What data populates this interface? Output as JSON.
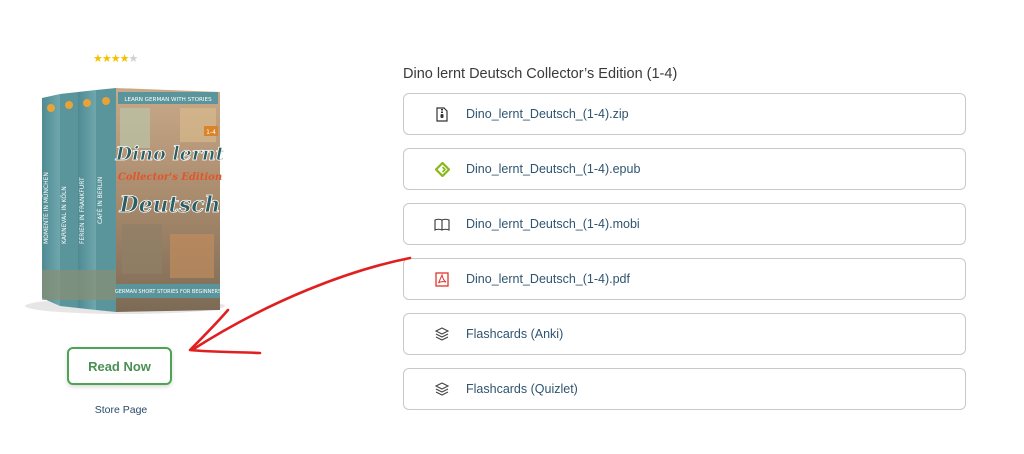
{
  "rating": {
    "value": 4.5,
    "max": 5
  },
  "cover": {
    "top_banner": "LEARN GERMAN WITH STORIES",
    "title_line1": "Dino lernt",
    "title_line2": "Deutsch",
    "edition": "Collector's Edition",
    "badge": "1-4",
    "subtitle": "GERMAN SHORT STORIES FOR BEGINNERS",
    "spines": [
      "CAFÉ IN BERLIN",
      "FERIEN IN FRANKFURT",
      "KARNEVAL IN KÖLN",
      "MOMENTE IN MÜNCHEN"
    ]
  },
  "read_button": {
    "label": "Read Now"
  },
  "store_link": {
    "label": "Store Page"
  },
  "downloads": {
    "title": "Dino lernt Deutsch Collector’s Edition (1-4)",
    "items": [
      {
        "label": "Dino_lernt_Deutsch_(1-4).zip",
        "icon": "zip-file-icon"
      },
      {
        "label": "Dino_lernt_Deutsch_(1-4).epub",
        "icon": "epub-icon"
      },
      {
        "label": "Dino_lernt_Deutsch_(1-4).mobi",
        "icon": "book-open-icon"
      },
      {
        "label": "Dino_lernt_Deutsch_(1-4).pdf",
        "icon": "pdf-icon"
      },
      {
        "label": "Flashcards (Anki)",
        "icon": "layers-icon"
      },
      {
        "label": "Flashcards (Quizlet)",
        "icon": "layers-icon"
      }
    ]
  },
  "colors": {
    "accent_green": "#4ca454",
    "link_blue": "#2e5470",
    "annotation_red": "#e02020",
    "star_gold": "#f2c200"
  }
}
